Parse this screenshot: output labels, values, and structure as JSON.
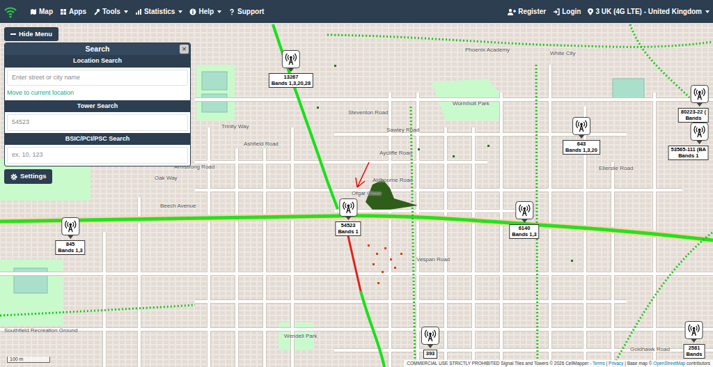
{
  "navbar": {
    "menu": [
      {
        "label": "Map",
        "dropdown": false
      },
      {
        "label": "Apps",
        "dropdown": false
      },
      {
        "label": "Tools",
        "dropdown": true
      },
      {
        "label": "Statistics",
        "dropdown": true
      },
      {
        "label": "Help",
        "dropdown": true
      },
      {
        "label": "Support",
        "dropdown": false
      }
    ],
    "account": [
      {
        "label": "Register"
      },
      {
        "label": "Login"
      }
    ],
    "network": {
      "label": "3 UK (4G LTE) - United Kingdom",
      "dropdown": true
    }
  },
  "sidebar": {
    "hide_button": "Hide Menu",
    "panel_title": "Search",
    "close": "×",
    "sections": [
      {
        "title": "Location Search",
        "placeholder": "Enter street or city name",
        "link": "Move to current location"
      },
      {
        "title": "Tower Search",
        "placeholder": "54523"
      },
      {
        "title": "BSIC/PCI/PSC Search",
        "placeholder": "ex. 10, 123"
      }
    ],
    "settings_button": "Settings"
  },
  "map": {
    "towers": [
      {
        "id": "13267",
        "bands": "Bands 1,3,20,28"
      },
      {
        "id": "643",
        "bands": "Bands 1,3,20"
      },
      {
        "id": "54523",
        "bands": "Bands 1"
      },
      {
        "id": "6140",
        "bands": "Bands 1,3"
      },
      {
        "id": "845",
        "bands": "Bands 1,3"
      },
      {
        "id": "393"
      },
      {
        "id": "2581",
        "bands": "Bands"
      },
      {
        "id": "80223-22 (",
        "bands": "Bands"
      },
      {
        "id": "53565-111 (BA",
        "bands": "Bands 1"
      }
    ],
    "street_labels": [
      "Phoenix Academy",
      "White City",
      "Trinity Way",
      "Steventon Road",
      "Sawley Road",
      "Wormholt Park",
      "Ashfield Road",
      "Aycliffe Road",
      "Aldbourne Road",
      "Ofgar Close",
      "Armstrong Road",
      "Oak Way",
      "Beech Avenue",
      "Ellerslie Road",
      "Vespan Road",
      "Southfield Recreation Ground",
      "Wendell Park",
      "Goldhawk Road"
    ],
    "scale": "100 m",
    "attribution": [
      {
        "text": "COMMERCIAL USE STRICTLY PROHIBITED Signal Tiles and Towers © 2026 CellMapper - ",
        "link": false
      },
      {
        "text": "Terms",
        "link": true
      },
      {
        "text": " | ",
        "link": false
      },
      {
        "text": "Privacy",
        "link": true
      },
      {
        "text": " | Base map © ",
        "link": false
      },
      {
        "text": "OpenStreetMap",
        "link": true
      },
      {
        "text": " contributors",
        "link": false
      }
    ]
  }
}
